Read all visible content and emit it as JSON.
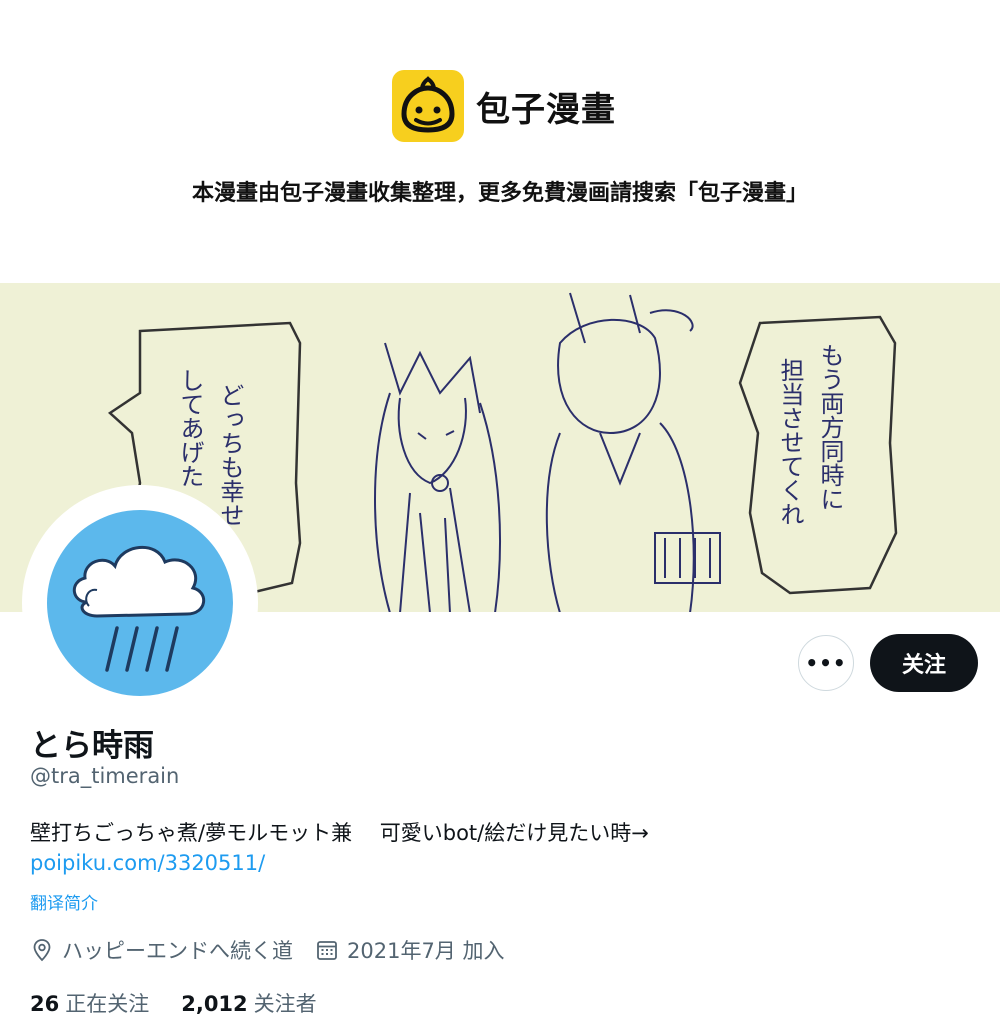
{
  "watermark": {
    "brand": "包子漫畫",
    "notice": "本漫畫由包子漫畫收集整理，更多免費漫画請搜索「包子漫畫」",
    "tile_color": "#f7cf1e"
  },
  "banner": {
    "background": "#eff1d6",
    "speech_left_col1": "どっちも幸せ",
    "speech_left_col2": "してあげた",
    "speech_right_col1": "もう両方同時に",
    "speech_right_col2": "担当させてくれ"
  },
  "profile": {
    "avatar_icon": "rain-cloud-icon",
    "more_icon": "more-icon",
    "more_label": "•••",
    "follow_label": "关注",
    "display_name": "とら時雨",
    "handle": "@tra_timerain",
    "bio": "壁打ちごっちゃ煮/夢モルモット兼　 可愛いbot/絵だけ見たい時→",
    "link": "poipiku.com/3320511/",
    "translate_label": "翻译简介",
    "location": "ハッピーエンドへ続く道",
    "joined": "2021年7月 加入",
    "following_count": "26",
    "following_label": "正在关注",
    "followers_count": "2,012",
    "followers_label": "关注者"
  },
  "colors": {
    "accent_link": "#1d9bf0",
    "secondary_text": "#536471",
    "follow_button": "#0f1419",
    "avatar_bg": "#5cb8ec"
  }
}
